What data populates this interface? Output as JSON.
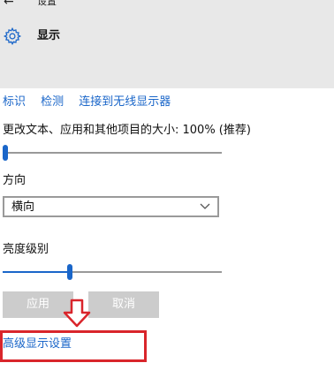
{
  "window": {
    "title": "设置"
  },
  "header": {
    "title": "显示"
  },
  "links": [
    "标识",
    "检测",
    "连接到无线显示器"
  ],
  "scale": {
    "label": "更改文本、应用和其他项目的大小: 100% (推荐)",
    "value_fraction": 0.0
  },
  "orientation": {
    "label": "方向",
    "selected": "横向"
  },
  "brightness": {
    "label": "亮度级别",
    "value_fraction": 0.3
  },
  "buttons": {
    "apply": "应用",
    "cancel": "取消"
  },
  "advanced_link": "高级显示设置",
  "colors": {
    "accent": "#1a66c9",
    "highlight": "#d9252b",
    "disabled_button": "#cccccc",
    "header_bg": "#e8e8e8"
  }
}
